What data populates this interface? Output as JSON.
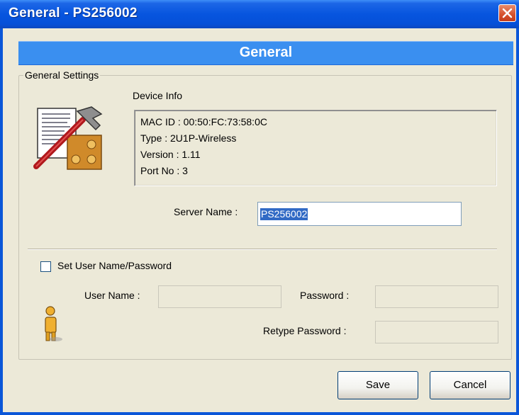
{
  "window": {
    "title": "General - PS256002",
    "close_icon": "close-icon"
  },
  "banner": {
    "title": "General"
  },
  "group": {
    "legend": "General Settings",
    "device_info_label": "Device Info",
    "device_info_icon": "device-settings-icon",
    "info_lines": [
      "MAC ID : 00:50:FC:73:58:0C",
      "Type : 2U1P-Wireless",
      "Version : 1.11",
      "Port No : 3"
    ],
    "server_name_label": "Server Name :",
    "server_name_value": "PS256002"
  },
  "auth": {
    "checkbox_label": "Set User Name/Password",
    "checked": false,
    "user_icon": "user-icon",
    "user_name_label": "User Name :",
    "password_label": "Password :",
    "retype_password_label": "Retype Password :",
    "user_name_value": "",
    "password_value": "",
    "retype_password_value": ""
  },
  "buttons": {
    "save": "Save",
    "cancel": "Cancel"
  },
  "colors": {
    "title_bar": "#0755df",
    "banner": "#3a8ff0",
    "dialog_background": "#ece9d8",
    "selection": "#316ac5"
  }
}
